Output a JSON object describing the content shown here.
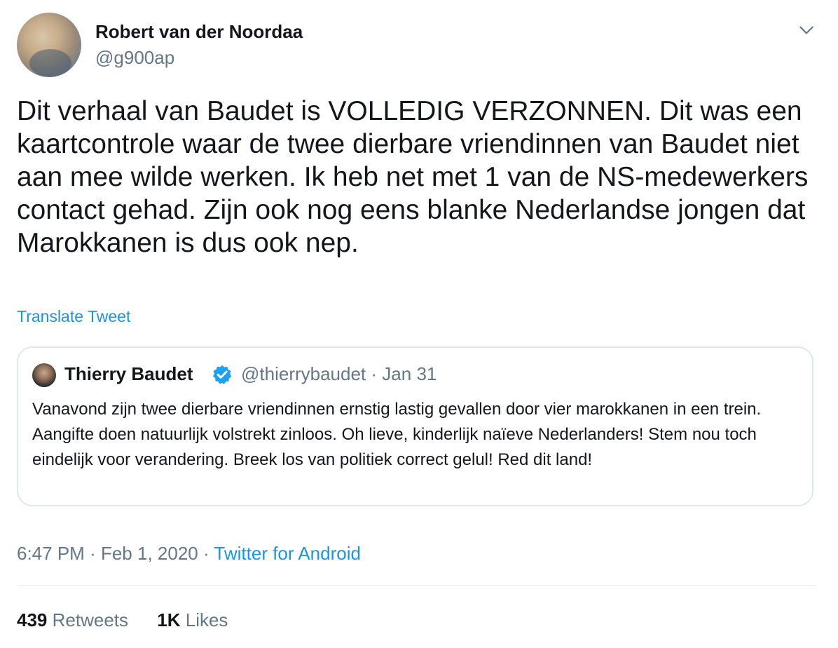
{
  "author": {
    "name": "Robert van der Noordaa",
    "handle": "@g900ap"
  },
  "tweet": {
    "text": "Dit verhaal van Baudet is VOLLEDIG VERZONNEN. Dit was een kaartcontrole waar de twee dierbare vriendinnen van Baudet niet aan mee wilde werken. Ik heb net met 1 van de NS-medewerkers contact gehad. Zijn ook nog eens blanke Nederlandse jongen dat Marokkanen is dus ook nep.",
    "translate_label": "Translate Tweet"
  },
  "quoted": {
    "name": "Thierry Baudet",
    "handle": "@thierrybaudet",
    "separator": "·",
    "date": "Jan 31",
    "text": "Vanavond zijn twee dierbare vriendinnen ernstig lastig gevallen door vier marokkanen in een trein. Aangifte doen natuurlijk volstrekt zinloos. Oh lieve, kinderlijk naïeve Nederlanders! Stem nou toch eindelijk voor verandering. Breek los van politiek correct gelul! Red dit land!",
    "verified_icon": "verified-badge-icon"
  },
  "meta": {
    "time": "6:47 PM",
    "sep1": "·",
    "date": "Feb 1, 2020",
    "sep2": "·",
    "source": "Twitter for Android"
  },
  "stats": {
    "retweets_count": "439",
    "retweets_label": "Retweets",
    "likes_count": "1K",
    "likes_label": "Likes"
  },
  "colors": {
    "link": "#1b95e0",
    "secondary_text": "#657786",
    "primary_text": "#14171a",
    "border": "#e1e8ed"
  },
  "icons": {
    "more_menu": "chevron-down-icon",
    "verified": "verified-badge-icon"
  }
}
